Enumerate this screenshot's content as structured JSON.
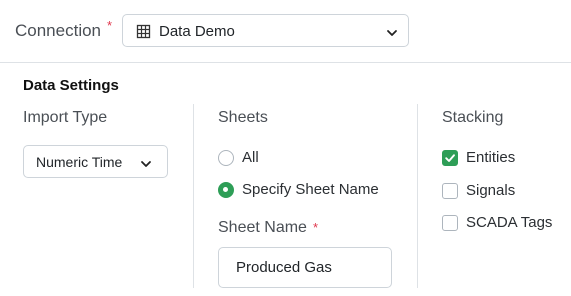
{
  "connection": {
    "label": "Connection",
    "required_mark": "*",
    "selected": "Data Demo",
    "icon": "spreadsheet-icon"
  },
  "data_settings": {
    "title": "Data Settings",
    "import_type": {
      "label": "Import Type",
      "selected": "Numeric Time"
    },
    "sheets": {
      "label": "Sheets",
      "options": [
        {
          "label": "All",
          "checked": false
        },
        {
          "label": "Specify Sheet Name",
          "checked": true
        }
      ],
      "sheet_name_label": "Sheet Name",
      "required_mark": "*",
      "sheet_name_value": "Produced Gas"
    },
    "stacking": {
      "label": "Stacking",
      "options": [
        {
          "label": "Entities",
          "checked": true
        },
        {
          "label": "Signals",
          "checked": false
        },
        {
          "label": "SCADA Tags",
          "checked": false
        }
      ]
    }
  },
  "colors": {
    "accent": "#2e9e57",
    "required": "#e0364c",
    "border": "#ced4da"
  }
}
